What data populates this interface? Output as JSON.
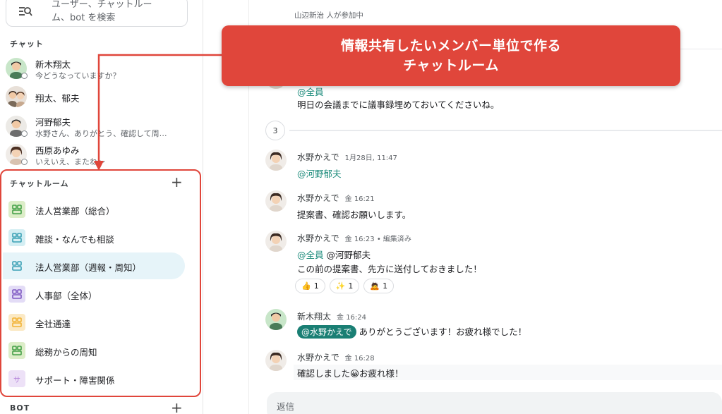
{
  "search": {
    "placeholder_line1": "ユーザー、チャットルー",
    "placeholder_line2": "ム、bot を検索"
  },
  "sidebar": {
    "chat_section": "チャット",
    "chats": [
      {
        "name": "新木翔太",
        "preview": "今どうなっていますか？"
      },
      {
        "name": "翔太、郁夫",
        "preview": ""
      },
      {
        "name": "河野郁夫",
        "preview": "水野さん、ありがとう、確認して周…"
      },
      {
        "name": "西原あゆみ",
        "preview": "いえいえ、またね〜"
      }
    ],
    "room_section": "チャットルーム",
    "rooms": [
      {
        "label": "法人営業部（総合）",
        "color": "#dcedc8",
        "icon_color": "#43a047"
      },
      {
        "label": "雑談・なんでも相談",
        "color": "#d4eef3",
        "icon_color": "#3aa0b5"
      },
      {
        "label": "法人営業部（週報・周知）",
        "color": "#d4eef3",
        "icon_color": "#3aa0b5",
        "active": true
      },
      {
        "label": "人事部（全体）",
        "color": "#e3dcf6",
        "icon_color": "#7e57c2"
      },
      {
        "label": "全社通達",
        "color": "#fbe9c4",
        "icon_color": "#f2b233"
      },
      {
        "label": "総務からの周知",
        "color": "#dcedc8",
        "icon_color": "#43a047"
      },
      {
        "label": "サポート・障害関係",
        "color": "#ede1f7",
        "icon_color": "#b07cd8",
        "letter": "サ"
      }
    ],
    "bot_section": "BOT"
  },
  "main": {
    "system_message": "山辺新治 人が参加中",
    "msg0_mention": "@全員",
    "msg0_text": "明日の会議までに議事録埋めておいてくださいね。",
    "thread_count": "3",
    "messages": [
      {
        "author": "水野かえで",
        "time": "1月28日, 11:47",
        "mention": "@河野郁夫"
      },
      {
        "author": "水野かえで",
        "time": "金 16:21",
        "text": "提案書、確認お願いします。"
      },
      {
        "author": "水野かえで",
        "time": "金 16:23 • 編集済み",
        "mention": "@全員",
        "mention2": "@河野郁夫",
        "text": "この前の提案書、先方に送付しておきました！"
      },
      {
        "author": "新木翔太",
        "time": "金 16:24",
        "chip": "@水野かえで",
        "text": "ありがとうございます！お疲れ様でした！"
      },
      {
        "author": "水野かえで",
        "time": "金 16:28",
        "text_a": "確認しました",
        "emoji": "😀",
        "text_b": "お疲れ様！"
      }
    ],
    "reactions": [
      {
        "emoji": "👍",
        "count": "1"
      },
      {
        "emoji": "✨",
        "count": "1"
      },
      {
        "emoji": "🙇",
        "count": "1"
      }
    ],
    "reply_placeholder": "返信"
  },
  "callout": {
    "line1": "情報共有したいメンバー単位で作る",
    "line2": "チャットルーム"
  },
  "colors": {
    "accent_red": "#e0463b",
    "mention_teal": "#1a8a7a",
    "chip_teal": "#1a7f74"
  }
}
